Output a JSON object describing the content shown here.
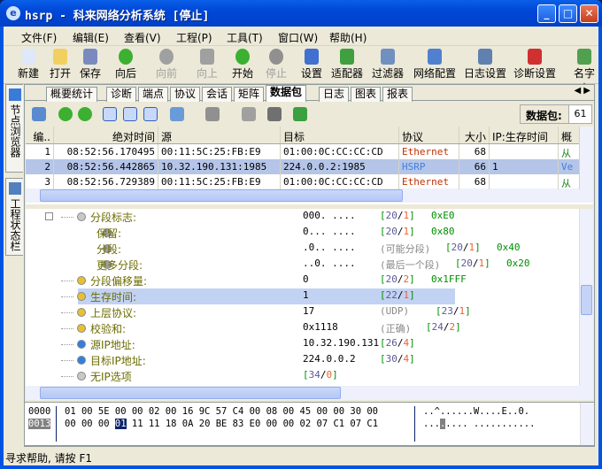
{
  "window": {
    "title": "hsrp - 科来网络分析系统 [停止]",
    "min": "_",
    "max": "□",
    "close": "✕"
  },
  "menu": [
    "文件(F)",
    "编辑(E)",
    "查看(V)",
    "工程(P)",
    "工具(T)",
    "窗口(W)",
    "帮助(H)"
  ],
  "toolbar": [
    {
      "label": "新建",
      "icon": "new-file-icon",
      "color": "#dfe8f8",
      "enabled": true
    },
    {
      "label": "打开",
      "icon": "open-folder-icon",
      "color": "#f2d060",
      "enabled": true
    },
    {
      "label": "保存",
      "icon": "save-disk-icon",
      "color": "#7a8ac0",
      "enabled": true
    },
    {
      "label": "向后",
      "icon": "back-arrow-icon",
      "color": "#3cb030",
      "enabled": true
    },
    {
      "label": "向前",
      "icon": "forward-arrow-icon",
      "color": "#a0a0a0",
      "enabled": false
    },
    {
      "label": "向上",
      "icon": "up-arrow-icon",
      "color": "#a0a0a0",
      "enabled": false
    },
    {
      "label": "开始",
      "icon": "play-icon",
      "color": "#3cb030",
      "enabled": true
    },
    {
      "label": "停止",
      "icon": "stop-icon",
      "color": "#909090",
      "enabled": false
    },
    {
      "label": "设置",
      "icon": "settings-icon",
      "color": "#4070d0",
      "enabled": true
    },
    {
      "label": "适配器",
      "icon": "adapter-icon",
      "color": "#40a040",
      "enabled": true
    },
    {
      "label": "过滤器",
      "icon": "filter-icon",
      "color": "#7090c0",
      "enabled": true
    },
    {
      "label": "网络配置",
      "icon": "network-config-icon",
      "color": "#5080d0",
      "enabled": true
    },
    {
      "label": "日志设置",
      "icon": "log-settings-icon",
      "color": "#6080b0",
      "enabled": true
    },
    {
      "label": "诊断设置",
      "icon": "diagnosis-settings-icon",
      "color": "#d03030",
      "enabled": true
    },
    {
      "label": "名字表",
      "icon": "name-table-icon",
      "color": "#50a050",
      "enabled": true
    }
  ],
  "side_tabs": [
    "节点浏览器",
    "工程状态栏"
  ],
  "tabs": [
    "概要统计",
    "诊断",
    "端点",
    "协议",
    "会话",
    "矩阵",
    "数据包",
    "日志",
    "图表",
    "报表"
  ],
  "active_tab": "数据包",
  "packet_count": {
    "label": "数据包:",
    "value": "61"
  },
  "packets": {
    "columns": [
      "编..",
      "绝对时间",
      "源",
      "目标",
      "协议",
      "大小",
      "IP:生存时间",
      "概"
    ],
    "rows": [
      [
        "1",
        "08:52:56.170495",
        "00:11:5C:25:FB:E9",
        "01:00:0C:CC:CC:CD",
        "Ethernet",
        "68",
        "",
        "从"
      ],
      [
        "2",
        "08:52:56.442865",
        "10.32.190.131:1985",
        "224.0.0.2:1985",
        "HSRP",
        "66",
        "1",
        "Ve"
      ],
      [
        "3",
        "08:52:56.729389",
        "00:11:5C:25:FB:E9",
        "01:00:0C:CC:CC:CD",
        "Ethernet",
        "68",
        "",
        "从"
      ]
    ],
    "selected_row": 1,
    "protocol_colors": {
      "Ethernet": "#c03000",
      "HSRP": "#4080e0"
    }
  },
  "decode": [
    {
      "label": "分段标志:",
      "value": "000. ....",
      "note": "",
      "off": "20",
      "len": "1",
      "hex": "0xE0",
      "level": 1,
      "expander": "⊟"
    },
    {
      "label": "保留:",
      "value": "0... ....",
      "note": "",
      "off": "20",
      "len": "1",
      "hex": "0x80",
      "level": 2
    },
    {
      "label": "分段:",
      "value": ".0.. ....",
      "note": "(可能分段)",
      "off": "20",
      "len": "1",
      "hex": "0x40",
      "level": 2
    },
    {
      "label": "更多分段:",
      "value": "..0. ....",
      "note": "(最后一个段)",
      "off": "20",
      "len": "1",
      "hex": "0x20",
      "level": 2
    },
    {
      "label": "分段偏移量:",
      "value": "0",
      "note": "",
      "off": "20",
      "len": "2",
      "hex": "0x1FFF",
      "level": 1
    },
    {
      "label": "生存时间:",
      "value": "1",
      "note": "",
      "off": "22",
      "len": "1",
      "hex": "",
      "level": 1,
      "selected": true
    },
    {
      "label": "上层协议:",
      "value": "17",
      "note": "(UDP)",
      "off": "23",
      "len": "1",
      "hex": "",
      "level": 1
    },
    {
      "label": "校验和:",
      "value": "0x1118",
      "note": "(正确)",
      "off": "24",
      "len": "2",
      "hex": "",
      "level": 1
    },
    {
      "label": "源IP地址:",
      "value": "10.32.190.131",
      "note": "",
      "off": "26",
      "len": "4",
      "hex": "",
      "level": 1
    },
    {
      "label": "目标IP地址:",
      "value": "224.0.0.2",
      "note": "",
      "off": "30",
      "len": "4",
      "hex": "",
      "level": 1
    },
    {
      "label": "无IP选项",
      "value": "",
      "note": "",
      "off": "34",
      "len": "0",
      "hex": "",
      "level": 1
    }
  ],
  "hex": {
    "rows": [
      {
        "offset": "0000",
        "pre": "01 00 5E 00 00 02 00 16 9C 57 C4 00 08 00 45 00 00 30 00",
        "sel": "",
        "post": "",
        "ascii_pre": "..^......W....E..0.",
        "ascii_sel": "",
        "ascii_post": ""
      },
      {
        "offset": "0013",
        "pre": "00 00 00 ",
        "sel": "01",
        "post": " 11 11 18 0A 20 BE 83 E0 00 00 02 07 C1 07 C1",
        "ascii_pre": "...",
        "ascii_sel": ".",
        "ascii_post": ".... ..........."
      }
    ]
  },
  "status": "寻求帮助, 请按 F1"
}
